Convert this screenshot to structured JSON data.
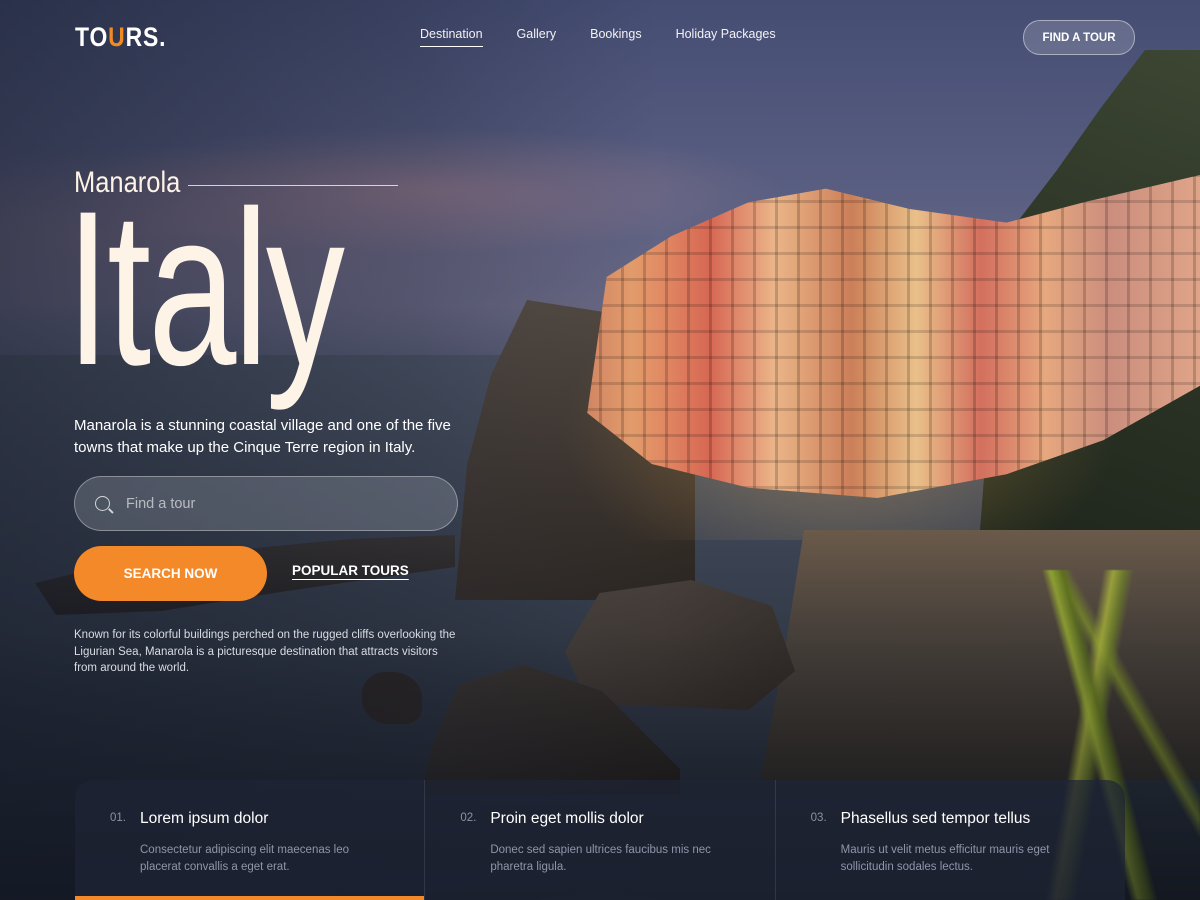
{
  "header": {
    "logo": {
      "prefix": "TO",
      "accent": "U",
      "suffix": "RS."
    },
    "nav": [
      {
        "label": "Destination",
        "active": true
      },
      {
        "label": "Gallery",
        "active": false
      },
      {
        "label": "Bookings",
        "active": false
      },
      {
        "label": "Holiday Packages",
        "active": false
      }
    ],
    "cta_label": "FIND A TOUR"
  },
  "hero": {
    "subtitle": "Manarola",
    "title": "Italy",
    "description": "Manarola is a stunning coastal village and one of the five towns that make up the Cinque Terre region in Italy.",
    "search": {
      "placeholder": "Find a tour",
      "value": ""
    },
    "search_button": "SEARCH NOW",
    "popular_link": "POPULAR TOURS",
    "note": "Known for its colorful buildings perched on the rugged cliffs overlooking the Ligurian Sea, Manarola is a picturesque destination that attracts visitors from around the world."
  },
  "features": [
    {
      "num": "01.",
      "title": "Lorem ipsum dolor",
      "text": "Consectetur adipiscing elit maecenas leo placerat convallis a eget erat.",
      "active": true
    },
    {
      "num": "02.",
      "title": "Proin eget mollis dolor",
      "text": "Donec sed sapien ultrices faucibus mis nec pharetra ligula.",
      "active": false
    },
    {
      "num": "03.",
      "title": "Phasellus sed tempor tellus",
      "text": "Mauris ut velit metus efficitur mauris eget sollicitudin sodales lectus.",
      "active": false
    }
  ],
  "colors": {
    "accent": "#f4892a",
    "hero_text": "#fdf3e6"
  },
  "icons": {
    "search": "search-icon"
  }
}
